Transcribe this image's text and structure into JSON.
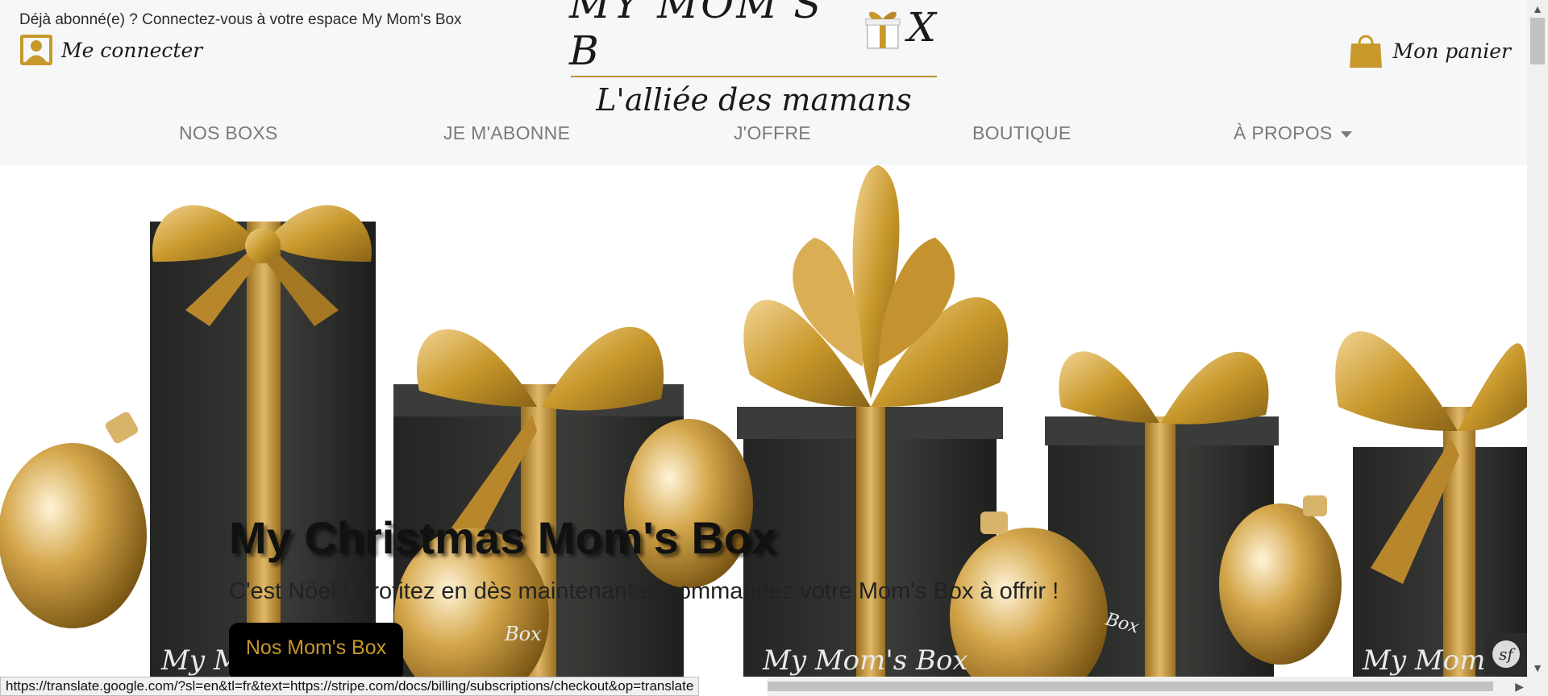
{
  "header": {
    "already_subscribed": "Déjà abonné(e) ? Connectez-vous à votre espace My Mom's Box",
    "login_label": "Me connecter",
    "logo_title_left": "MY MOM'S B",
    "logo_title_right": "X",
    "tagline": "L'alliée des mamans",
    "cart_label": "Mon panier",
    "icons": {
      "login": "user-icon",
      "cart": "shopping-bag-icon",
      "logo_gift": "gift-box-icon"
    }
  },
  "nav": {
    "items": [
      {
        "label": "NOS BOXS"
      },
      {
        "label": "JE M'ABONNE"
      },
      {
        "label": "J'OFFRE"
      },
      {
        "label": "BOUTIQUE"
      },
      {
        "label": "À PROPOS",
        "has_dropdown": true
      }
    ]
  },
  "hero": {
    "title": "My Christmas Mom's Box",
    "subtitle": "C'est Nöel ! Profitez en dès maintenant et commandez votre Mom's Box à offrir !",
    "cta_label": "Nos Mom's Box",
    "box_watermark": "My Mom's Box",
    "box_watermark_short": "Box",
    "icons": {
      "prev": "chevron-left-icon",
      "next": "chevron-right-icon"
    }
  },
  "debug_toolbar": {
    "label": "sf"
  },
  "status_bar": {
    "url": "https://translate.google.com/?sl=en&tl=fr&text=https://stripe.com/docs/billing/subscriptions/checkout&op=translate"
  },
  "colors": {
    "gold": "#c8982b",
    "header_bg": "#f6f7f8",
    "nav_text": "#7a7a7a",
    "box_dark": "#2e2f2d"
  }
}
